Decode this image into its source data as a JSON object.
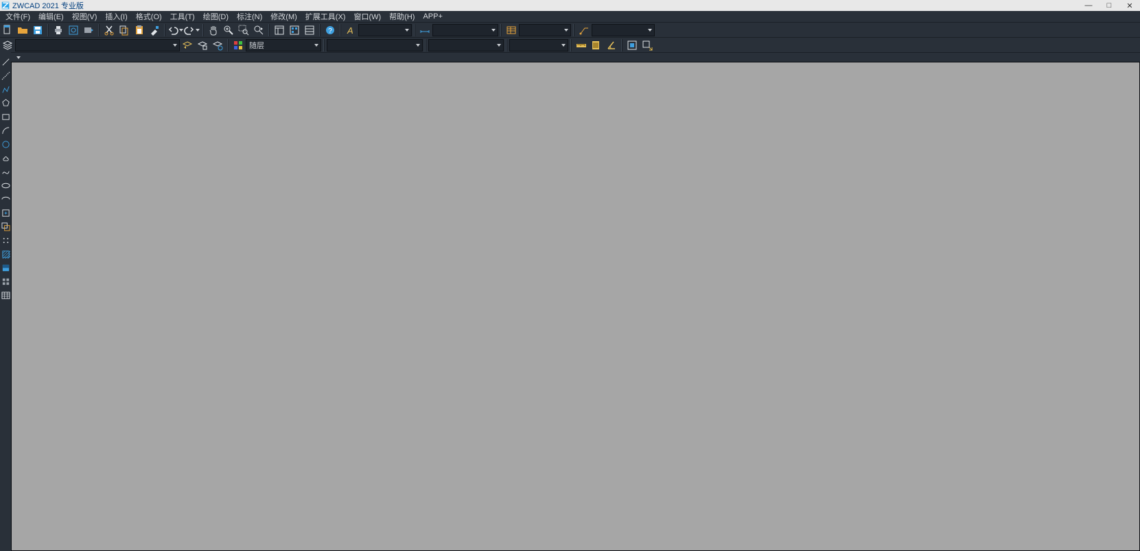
{
  "title": "ZWCAD 2021 专业版",
  "menu": {
    "file": "文件(F)",
    "edit": "编辑(E)",
    "view": "视图(V)",
    "insert": "插入(I)",
    "format": "格式(O)",
    "tools": "工具(T)",
    "draw": "绘图(D)",
    "dim": "标注(N)",
    "modify": "修改(M)",
    "ext": "扩展工具(X)",
    "window": "窗口(W)",
    "help": "帮助(H)",
    "app": "APP+"
  },
  "combo": {
    "layer": "随层"
  }
}
